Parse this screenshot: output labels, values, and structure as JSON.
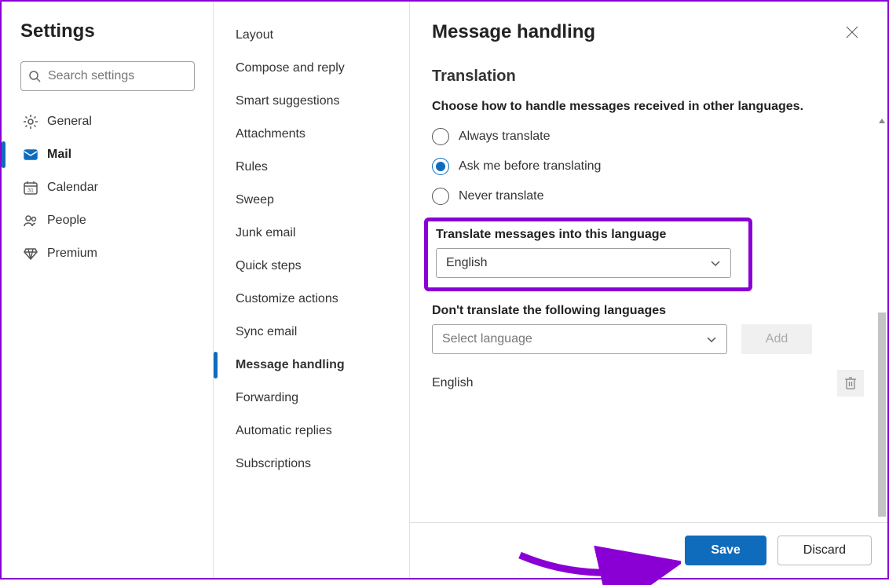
{
  "settings": {
    "title": "Settings",
    "search_placeholder": "Search settings",
    "nav": [
      {
        "key": "general",
        "label": "General",
        "icon": "gear",
        "active": false
      },
      {
        "key": "mail",
        "label": "Mail",
        "icon": "mail",
        "active": true
      },
      {
        "key": "calendar",
        "label": "Calendar",
        "icon": "calendar",
        "active": false
      },
      {
        "key": "people",
        "label": "People",
        "icon": "people",
        "active": false
      },
      {
        "key": "premium",
        "label": "Premium",
        "icon": "diamond",
        "active": false
      }
    ]
  },
  "mail_subnav": [
    {
      "key": "layout",
      "label": "Layout"
    },
    {
      "key": "compose-reply",
      "label": "Compose and reply"
    },
    {
      "key": "smart-suggestions",
      "label": "Smart suggestions"
    },
    {
      "key": "attachments",
      "label": "Attachments"
    },
    {
      "key": "rules",
      "label": "Rules"
    },
    {
      "key": "sweep",
      "label": "Sweep"
    },
    {
      "key": "junk-email",
      "label": "Junk email"
    },
    {
      "key": "quick-steps",
      "label": "Quick steps"
    },
    {
      "key": "customize-actions",
      "label": "Customize actions"
    },
    {
      "key": "sync-email",
      "label": "Sync email"
    },
    {
      "key": "message-handling",
      "label": "Message handling",
      "active": true
    },
    {
      "key": "forwarding",
      "label": "Forwarding"
    },
    {
      "key": "automatic-replies",
      "label": "Automatic replies"
    },
    {
      "key": "subscriptions",
      "label": "Subscriptions"
    }
  ],
  "panel": {
    "title": "Message handling",
    "section_title": "Translation",
    "description": "Choose how to handle messages received in other languages.",
    "translate_options": [
      {
        "key": "always",
        "label": "Always translate",
        "checked": false
      },
      {
        "key": "ask",
        "label": "Ask me before translating",
        "checked": true
      },
      {
        "key": "never",
        "label": "Never translate",
        "checked": false
      }
    ],
    "target_lang": {
      "label": "Translate messages into this language",
      "value": "English"
    },
    "exclude": {
      "label": "Don't translate the following languages",
      "placeholder": "Select language",
      "add_label": "Add",
      "items": [
        "English"
      ]
    }
  },
  "footer": {
    "save": "Save",
    "discard": "Discard"
  }
}
